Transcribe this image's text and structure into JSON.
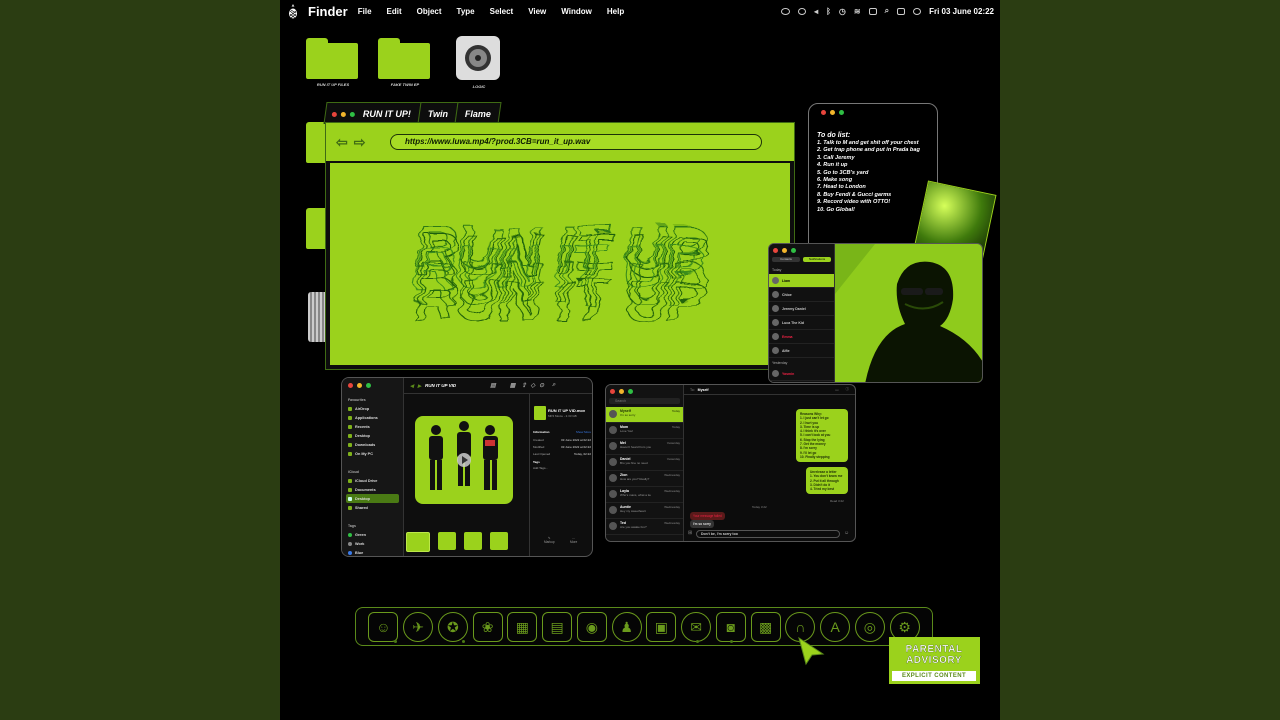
{
  "menubar": {
    "app_name": "Finder",
    "menus": [
      "File",
      "Edit",
      "Object",
      "Type",
      "Select",
      "View",
      "Window",
      "Help"
    ],
    "datetime": "Fri 03 June  02:22"
  },
  "desktop": {
    "folders": [
      {
        "label": "RUN IT UP FILES"
      },
      {
        "label": "FAKE TWIN EP"
      },
      {
        "label": "LOGIC"
      }
    ]
  },
  "browser": {
    "tabs": [
      "RUN IT UP!",
      "Twin",
      "Flame"
    ],
    "url": "https://www.luwa.mp4/?prod.3CB=run_it_up.wav",
    "title_art": "RUN IT UP"
  },
  "todo": {
    "title": "To do list:",
    "items": [
      "1. Talk to M and get shit off your chest",
      "2. Get trap phone and put in Prada bag",
      "3. Call Jeremy",
      "4. Run it up",
      "5. Go to 3CB's yard",
      "6. Make song",
      "7. Head to London",
      "8. Buy Fendi & Gucci garms",
      "9. Record video with OTTO!",
      "10. Go Global!"
    ]
  },
  "finder": {
    "title": "RUN IT UP VID",
    "sidebar": {
      "favourites_label": "Favourites",
      "favourites": [
        "AirDrop",
        "Applications",
        "Recents",
        "Desktop",
        "Downloads",
        "On My PC"
      ],
      "cloud_label": "iCloud",
      "cloud": [
        "iCloud Drive",
        "Documents",
        "Desktop",
        "Shared"
      ],
      "tags_label": "Tags",
      "tags": [
        "Green",
        "Work",
        "Blue"
      ]
    },
    "info": {
      "file_name": "RUN IT UP VID.mov",
      "file_sub": "MP4 Movie - 2.33 GB",
      "section": "Information",
      "show_more": "Show More",
      "rows": [
        {
          "k": "Created",
          "v": "03 June 2022 at 02:22"
        },
        {
          "k": "Modified",
          "v": "03 June 2022 at 02:22"
        },
        {
          "k": "Last Opened",
          "v": "Today, 02:22"
        }
      ],
      "tags_label": "Tags",
      "add_tags": "Add Tags...",
      "actions": [
        "Markup",
        "More"
      ]
    }
  },
  "imessage": {
    "search_placeholder": "Search",
    "to_label": "To:",
    "to_value": "Myself",
    "chats": [
      {
        "name": "Myself",
        "preview": "I'm so sorry",
        "time": "Today"
      },
      {
        "name": "Mom",
        "preview": "Love You!",
        "time": "Today"
      },
      {
        "name": "Mel",
        "preview": "Haven't heard from you",
        "time": "Yesterday"
      },
      {
        "name": "Daniel",
        "preview": "Bro you fine no need",
        "time": "Yesterday"
      },
      {
        "name": "Zion",
        "preview": "How are you? Really?",
        "time": "Wednesday"
      },
      {
        "name": "Layla",
        "preview": "Who's mans, what a tie",
        "time": "Wednesday"
      },
      {
        "name": "Auntie",
        "preview": "Hey my sweetheart",
        "time": "Wednesday"
      },
      {
        "name": "Ted",
        "preview": "Are you awake bro?",
        "time": "Wednesday"
      }
    ],
    "bubbles_right_1": [
      "Reasons Why:",
      "1. I just can't let go",
      "2. I hurt you",
      "3. Time is up",
      "4. I think it's over",
      "5. I can't look at you",
      "6. Stop the lying",
      "7. Get the money",
      "8. I'm sorry",
      "9. I'll let go",
      "10. Finally stepping"
    ],
    "bubbles_right_2": [
      "Unrelease a letter",
      "1. You don't know me",
      "2. Put it all through",
      "3. Didn't do it",
      "4. Tried my best"
    ],
    "read_label": "Read 3:22",
    "day_label": "Today 3:22",
    "red_bubble": "Your message failed",
    "grey_bubble": "I'm so sorry",
    "compose_text": "Don't be, I'm sorry too"
  },
  "msgwin": {
    "buttons": [
      "Contacts",
      "Notifications"
    ],
    "section_today": "Today",
    "section_yesterday": "Yesterday",
    "rows": [
      "Liam",
      "Chloe",
      "Jeremy Daniel",
      "Luca The Kid",
      "Emma",
      "Alfie",
      "Yasmin"
    ]
  },
  "advisory": {
    "line1": "PARENTAL",
    "line2": "ADVISORY",
    "line3": "EXPLICIT CONTENT"
  },
  "colors": {
    "accent": "#9bd21c",
    "bg": "#000000",
    "outer": "#2b3d12"
  }
}
